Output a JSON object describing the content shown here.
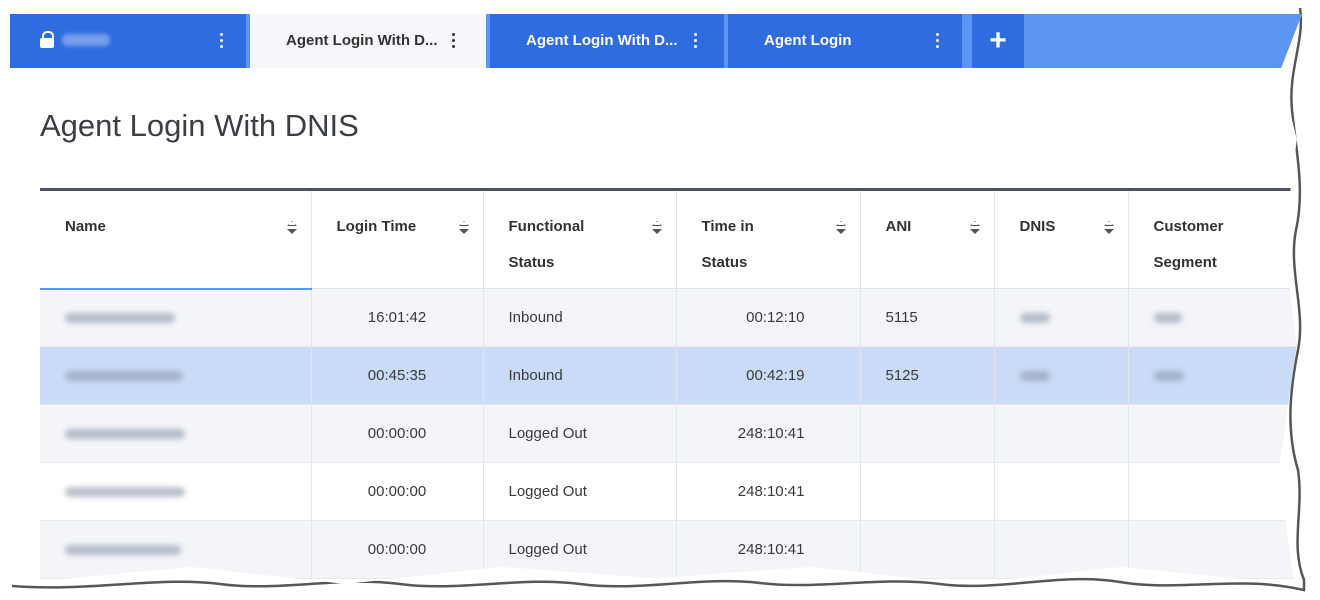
{
  "tabs": [
    {
      "label": "",
      "locked": true,
      "active": false
    },
    {
      "label": "Agent Login With D...",
      "active": true
    },
    {
      "label": "Agent Login With D...",
      "active": false
    },
    {
      "label": "Agent Login",
      "active": false
    }
  ],
  "add_tab_label": "+",
  "page_title": "Agent Login With DNIS",
  "table": {
    "columns": [
      {
        "label": "Name"
      },
      {
        "label": "Login Time"
      },
      {
        "label": "Functional Status"
      },
      {
        "label": "Time in Status"
      },
      {
        "label": "ANI"
      },
      {
        "label": "DNIS"
      },
      {
        "label": "Customer Segment"
      }
    ],
    "rows": [
      {
        "name": "",
        "login_time": "16:01:42",
        "status": "Inbound",
        "time_in_status": "00:12:10",
        "ani": "5115",
        "dnis": "",
        "segment": "",
        "selected": false
      },
      {
        "name": "",
        "login_time": "00:45:35",
        "status": "Inbound",
        "time_in_status": "00:42:19",
        "ani": "5125",
        "dnis": "",
        "segment": "",
        "selected": true
      },
      {
        "name": "",
        "login_time": "00:00:00",
        "status": "Logged Out",
        "time_in_status": "248:10:41",
        "ani": "",
        "dnis": "",
        "segment": "",
        "selected": false
      },
      {
        "name": "",
        "login_time": "00:00:00",
        "status": "Logged Out",
        "time_in_status": "248:10:41",
        "ani": "",
        "dnis": "",
        "segment": "",
        "selected": false
      },
      {
        "name": "",
        "login_time": "00:00:00",
        "status": "Logged Out",
        "time_in_status": "248:10:41",
        "ani": "",
        "dnis": "",
        "segment": "",
        "selected": false
      }
    ]
  },
  "colors": {
    "tab_bar": "#5b96f5",
    "tab": "#2f6ce0",
    "active_tab": "#f6f8fb",
    "selected_row": "#c9dbf7",
    "header_rule": "#4b5160"
  }
}
